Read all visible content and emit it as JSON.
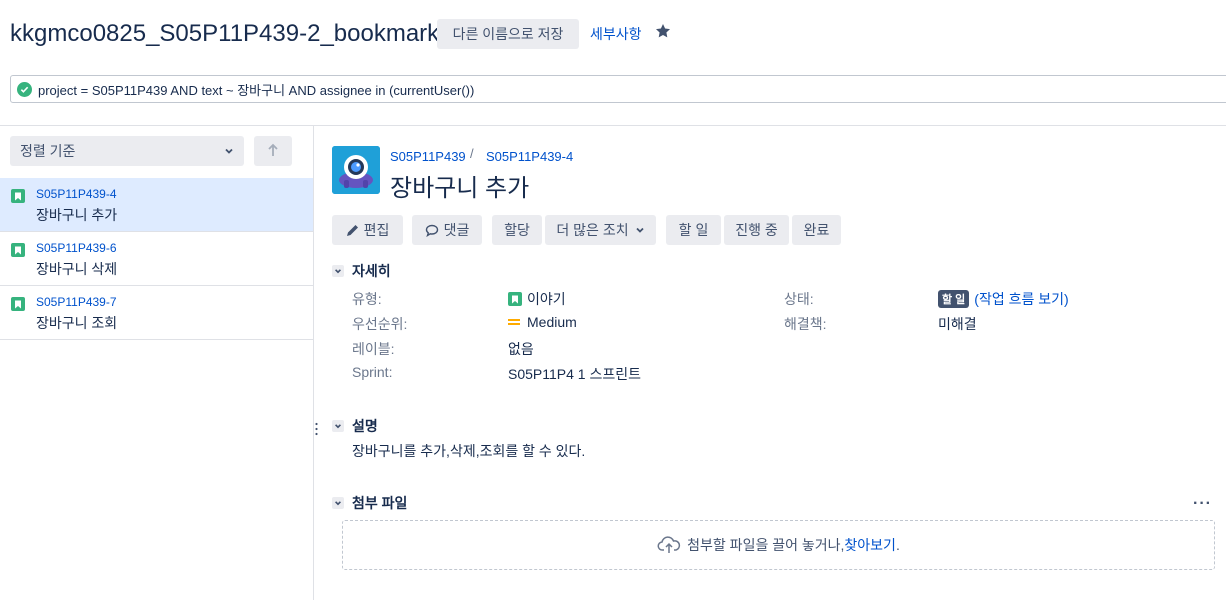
{
  "header": {
    "filter_title": "kkgmco0825_S05P11P439-2_bookmark",
    "save_as_label": "다른 이름으로 저장",
    "details_label": "세부사항"
  },
  "jql": {
    "query": "project = S05P11P439 AND text ~ 장바구니 AND assignee in (currentUser())"
  },
  "sidebar": {
    "sort_label": "정렬 기준",
    "issues": [
      {
        "key": "S05P11P439-4",
        "summary": "장바구니 추가"
      },
      {
        "key": "S05P11P439-6",
        "summary": "장바구니 삭제"
      },
      {
        "key": "S05P11P439-7",
        "summary": "장바구니 조회"
      }
    ]
  },
  "issue": {
    "project_key": "S05P11P439",
    "issue_key": "S05P11P439-4",
    "title": "장바구니 추가",
    "toolbar": {
      "edit": "편집",
      "comment": "댓글",
      "assign": "할당",
      "more": "더 많은 조치",
      "todo": "할 일",
      "in_progress": "진행 중",
      "done": "완료"
    },
    "details": {
      "heading": "자세히",
      "type_label": "유형:",
      "type_value": "이야기",
      "priority_label": "우선순위:",
      "priority_value": "Medium",
      "labels_label": "레이블:",
      "labels_value": "없음",
      "sprint_label": "Sprint:",
      "sprint_value": "S05P11P4 1 스프린트",
      "status_label": "상태:",
      "status_value": "할 일",
      "workflow_link": "(작업 흐름 보기)",
      "resolution_label": "해결책:",
      "resolution_value": "미해결"
    },
    "description": {
      "heading": "설명",
      "text": "장바구니를 추가,삭제,조회를 할 수 있다."
    },
    "attachments": {
      "heading": "첨부 파일",
      "drop_text": "첨부할 파일을 끌어 놓거나, ",
      "browse_link": "찾아보기",
      "drop_suffix": "."
    }
  },
  "colors": {
    "link": "#0052cc",
    "story_green": "#36b37e",
    "selected_bg": "#deebff",
    "priority_medium": "#ffab00",
    "status_todo": "#42526e"
  }
}
